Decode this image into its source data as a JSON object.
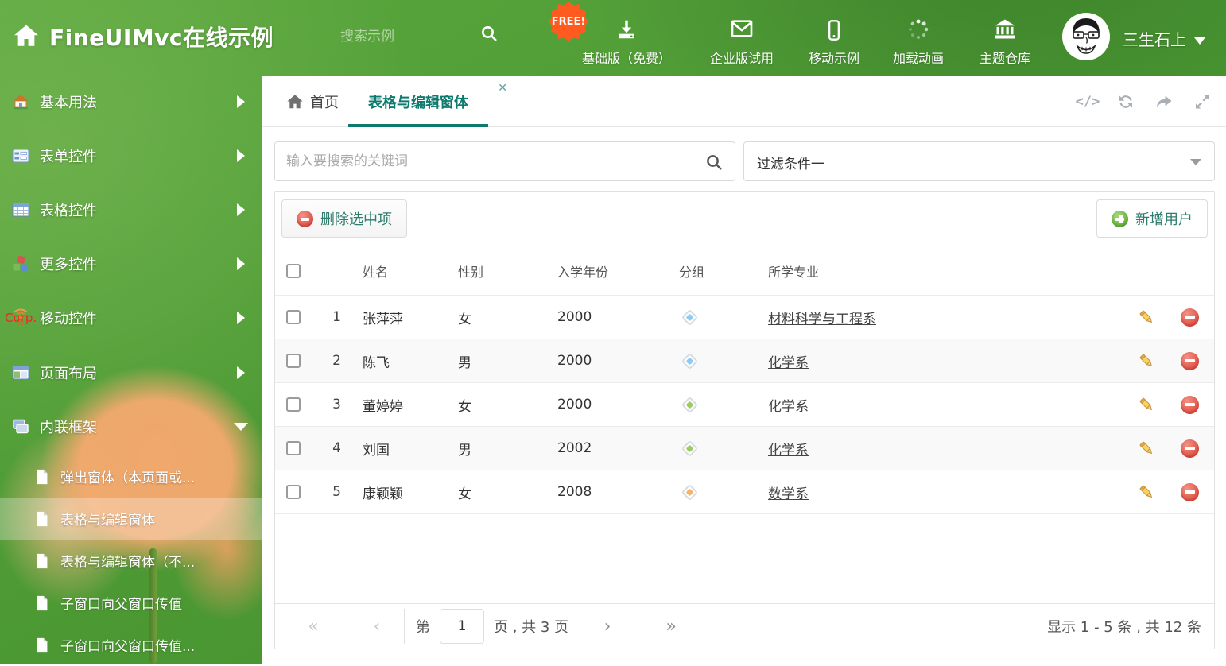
{
  "header": {
    "title": "FineUIMvc在线示例",
    "search_placeholder": "搜索示例",
    "free_badge": "FREE!",
    "menu": [
      {
        "label": "基础版（免费）"
      },
      {
        "label": "企业版试用"
      },
      {
        "label": "移动示例"
      },
      {
        "label": "加载动画"
      },
      {
        "label": "主题仓库"
      }
    ],
    "user_name": "三生石上"
  },
  "sidebar": {
    "items": [
      {
        "label": "基本用法"
      },
      {
        "label": "表单控件"
      },
      {
        "label": "表格控件"
      },
      {
        "label": "更多控件"
      },
      {
        "label": "移动控件",
        "badge": "Corp."
      },
      {
        "label": "页面布局"
      },
      {
        "label": "内联框架"
      }
    ],
    "subitems": [
      {
        "label": "弹出窗体（本页面或..."
      },
      {
        "label": "表格与编辑窗体"
      },
      {
        "label": "表格与编辑窗体（不..."
      },
      {
        "label": "子窗口向父窗口传值"
      },
      {
        "label": "子窗口向父窗口传值..."
      }
    ]
  },
  "tabs": [
    {
      "label": "首页"
    },
    {
      "label": "表格与编辑窗体"
    }
  ],
  "filters": {
    "search_placeholder": "输入要搜索的关键词",
    "filter_selected": "过滤条件一"
  },
  "grid": {
    "delete_button": "删除选中项",
    "add_button": "新增用户",
    "columns": {
      "name": "姓名",
      "gender": "性别",
      "year": "入学年份",
      "group": "分组",
      "major": "所学专业"
    },
    "rows": [
      {
        "num": "1",
        "name": "张萍萍",
        "gender": "女",
        "year": "2000",
        "tag_color": "#8DCBF2",
        "major": "材料科学与工程系"
      },
      {
        "num": "2",
        "name": "陈飞",
        "gender": "男",
        "year": "2000",
        "tag_color": "#8DCBF2",
        "major": "化学系"
      },
      {
        "num": "3",
        "name": "董婷婷",
        "gender": "女",
        "year": "2000",
        "tag_color": "#9DCB63",
        "major": "化学系"
      },
      {
        "num": "4",
        "name": "刘国",
        "gender": "男",
        "year": "2002",
        "tag_color": "#9DCB63",
        "major": "化学系"
      },
      {
        "num": "5",
        "name": "康颖颖",
        "gender": "女",
        "year": "2008",
        "tag_color": "#F6B26F",
        "major": "数学系"
      }
    ],
    "pagination": {
      "first": "«",
      "prev": "‹",
      "page_prefix": "第",
      "page_value": "1",
      "page_suffix": "页 , 共 3 页",
      "next": "›",
      "last": "»",
      "summary": "显示 1 - 5 条 , 共 12 条"
    }
  },
  "colors": {
    "accent_teal": "#0E7A6F",
    "header_green": "#4D9A34",
    "danger_red": "#DD4F41",
    "success_green": "#67AE3E"
  }
}
